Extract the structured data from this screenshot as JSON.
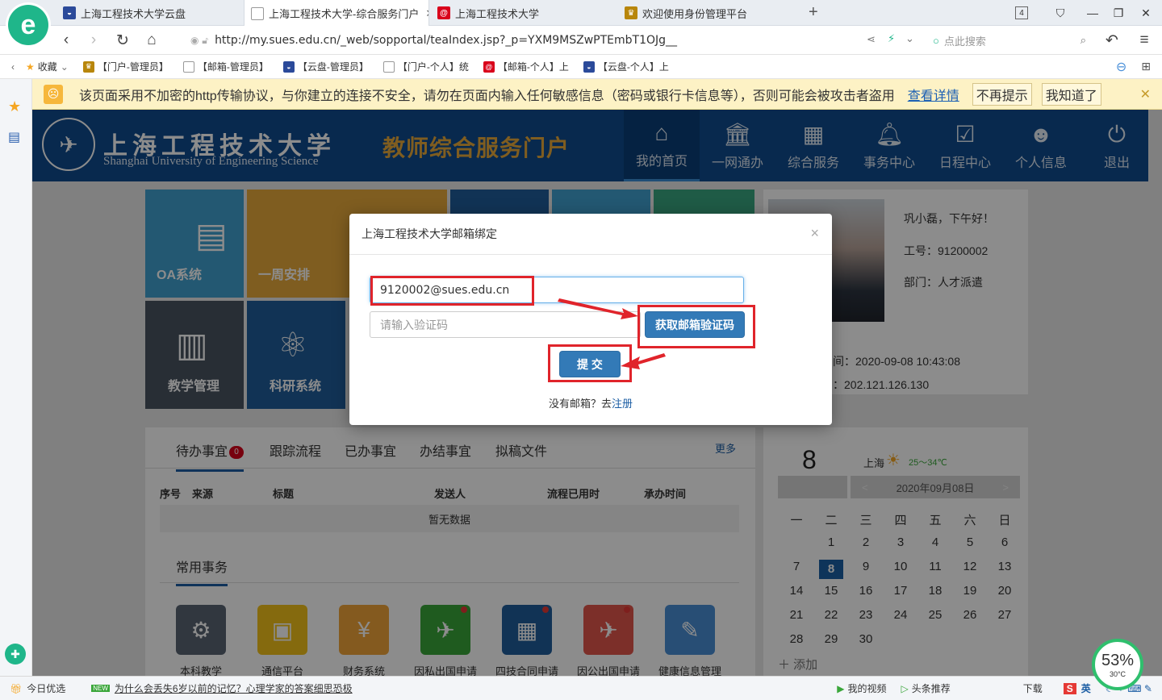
{
  "browser": {
    "logo": "e",
    "tabs": [
      {
        "label": "上海工程技术大学云盘",
        "active": false
      },
      {
        "label": "上海工程技术大学-综合服务门户",
        "active": true
      },
      {
        "label": "上海工程技术大学",
        "active": false
      },
      {
        "label": "欢迎使用身份管理平台",
        "active": false
      }
    ],
    "tab_counter": "4",
    "new_tab": "+",
    "url": "http://my.sues.edu.cn/_web/sopportal/teaIndex.jsp?_p=YXM9MSZwPTEmbT1OJg__",
    "search_placeholder": "点此搜索",
    "favorites_label": "收藏",
    "favorites": [
      {
        "label": "【门户-管理员】",
        "color": "#b8860b"
      },
      {
        "label": "【邮箱-管理员】",
        "color": "#9e9e9e"
      },
      {
        "label": "【云盘-管理员】",
        "color": "#2b4a9a"
      },
      {
        "label": "【门户-个人】统",
        "color": "#9e9e9e"
      },
      {
        "label": "【邮箱-个人】上",
        "color": "#d9001b"
      },
      {
        "label": "【云盘-个人】上",
        "color": "#2b4a9a"
      }
    ]
  },
  "warning": {
    "text": "该页面采用不加密的http传输协议，与你建立的连接不安全，请勿在页面内输入任何敏感信息（密码或银行卡信息等），否则可能会被攻击者盗用",
    "details_link": "查看详情",
    "no_remind": "不再提示",
    "got_it": "我知道了"
  },
  "header": {
    "university_cn": "上海工程技术大学",
    "university_en": "Shanghai University of  Engineering Science",
    "portal_title": "教师综合服务门户",
    "nav": [
      {
        "label": "我的首页",
        "icon": "home-icon",
        "active": true
      },
      {
        "label": "一网通办",
        "icon": "bank-icon",
        "active": false
      },
      {
        "label": "综合服务",
        "icon": "grid-icon",
        "active": false
      },
      {
        "label": "事务中心",
        "icon": "bell-icon",
        "active": false
      },
      {
        "label": "日程中心",
        "icon": "calendar-check-icon",
        "active": false
      },
      {
        "label": "个人信息",
        "icon": "user-icon",
        "active": false
      },
      {
        "label": "退出",
        "icon": "power-icon",
        "active": false
      }
    ]
  },
  "tiles": [
    {
      "label": "OA系统",
      "color": "#41a1cf"
    },
    {
      "label": "一周安排",
      "color": "#e8a93b"
    },
    {
      "label": "教学管理",
      "color": "#4a5462"
    },
    {
      "label": "科研系统",
      "color": "#1f5e9c"
    }
  ],
  "profile": {
    "greeting": "巩小磊，下午好！",
    "staff_id": "工号：91200002",
    "department": "部门：人才派遣",
    "login_time": "间：2020-09-08 10:43:08",
    "login_ip": "：202.121.126.130"
  },
  "todo": {
    "tabs": [
      {
        "label": "待办事宜",
        "badge": "0",
        "active": true
      },
      {
        "label": "跟踪流程"
      },
      {
        "label": "已办事宜"
      },
      {
        "label": "办结事宜"
      },
      {
        "label": "拟稿文件"
      }
    ],
    "more": "更多",
    "columns": [
      "序号",
      "来源",
      "标题",
      "发送人",
      "流程已用时",
      "承办时间"
    ],
    "empty": "暂无数据",
    "common_title": "常用事务",
    "common_items": [
      {
        "label": "本科教学",
        "color": "#5a6573",
        "icon": "monitor-gear-icon",
        "dot": false
      },
      {
        "label": "通信平台",
        "color": "#f2c21b",
        "icon": "box-icon",
        "dot": false
      },
      {
        "label": "财务系统",
        "color": "#f0a53a",
        "icon": "money-bag-icon",
        "dot": false
      },
      {
        "label": "因私出国申请",
        "color": "#3aa63a",
        "icon": "airplane-icon",
        "dot": true
      },
      {
        "label": "四技合同申请",
        "color": "#1f5e9c",
        "icon": "contract-icon",
        "dot": true
      },
      {
        "label": "因公出国申请",
        "color": "#e2574c",
        "icon": "airplane-hand-icon",
        "dot": true
      },
      {
        "label": "健康信息管理",
        "color": "#4a8fd6",
        "icon": "health-doc-icon",
        "dot": false
      }
    ]
  },
  "calendar": {
    "day": "8",
    "city": "上海",
    "temp": "25～34℃",
    "month_title": "2020年09月08日",
    "prev": "<",
    "next": ">",
    "weekdays": [
      "一",
      "二",
      "三",
      "四",
      "五",
      "六",
      "日"
    ],
    "weeks": [
      [
        "",
        "1",
        "2",
        "3",
        "4",
        "5",
        "6"
      ],
      [
        "7",
        "8",
        "9",
        "10",
        "11",
        "12",
        "13"
      ],
      [
        "14",
        "15",
        "16",
        "17",
        "18",
        "19",
        "20"
      ],
      [
        "21",
        "22",
        "23",
        "24",
        "25",
        "26",
        "27"
      ],
      [
        "28",
        "29",
        "30",
        "",
        "",
        "",
        ""
      ]
    ],
    "selected": "8",
    "add": "添加"
  },
  "modal": {
    "title": "上海工程技术大学邮箱绑定",
    "close": "×",
    "email_value": "9120002@sues.edu.cn",
    "code_placeholder": "请输入验证码",
    "get_code": "获取邮箱验证码",
    "submit": "提 交",
    "no_email": "没有邮箱？去",
    "register": "注册"
  },
  "statusbar": {
    "today": "今日优选",
    "news_badge": "NEW",
    "news": "为什么会丢失6岁以前的记忆？心理学家的答案细思恐极",
    "video": "我的视频",
    "headline": "头条推荐",
    "download": "下载",
    "ime": "英"
  },
  "weather_widget": {
    "percent": "53%",
    "temp": "30°C"
  }
}
